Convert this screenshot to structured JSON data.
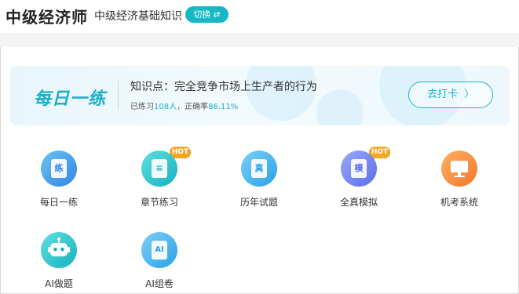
{
  "header": {
    "app_title": "中级经济师",
    "subject": "中级经济基础知识",
    "switch_label": "切换"
  },
  "banner": {
    "daily_title": "每日一练",
    "knowledge_point": "知识点：完全竞争市场上生产者的行为",
    "practiced_prefix": "已练习",
    "practiced_count": "108人",
    "accuracy_prefix": "，正确率",
    "accuracy_value": "86.11%",
    "checkin_label": "去打卡"
  },
  "features": [
    {
      "label": "每日一练",
      "icon": "practice-icon",
      "glyph": "练",
      "hot": false
    },
    {
      "label": "章节练习",
      "icon": "chapter-icon",
      "glyph": "≡",
      "hot": true,
      "badge": "HOT"
    },
    {
      "label": "历年试题",
      "icon": "past-exam-icon",
      "glyph": "真",
      "hot": false
    },
    {
      "label": "全真模拟",
      "icon": "mock-exam-icon",
      "glyph": "模",
      "hot": true,
      "badge": "HOT"
    },
    {
      "label": "机考系统",
      "icon": "computer-exam-icon",
      "glyph": "",
      "hot": false
    },
    {
      "label": "AI做题",
      "icon": "ai-robot-icon",
      "glyph": "",
      "hot": false
    },
    {
      "label": "AI组卷",
      "icon": "ai-paper-icon",
      "glyph": "AI",
      "hot": false
    }
  ],
  "colors": {
    "accent": "#16b8c4",
    "hot": "#f5a623"
  }
}
